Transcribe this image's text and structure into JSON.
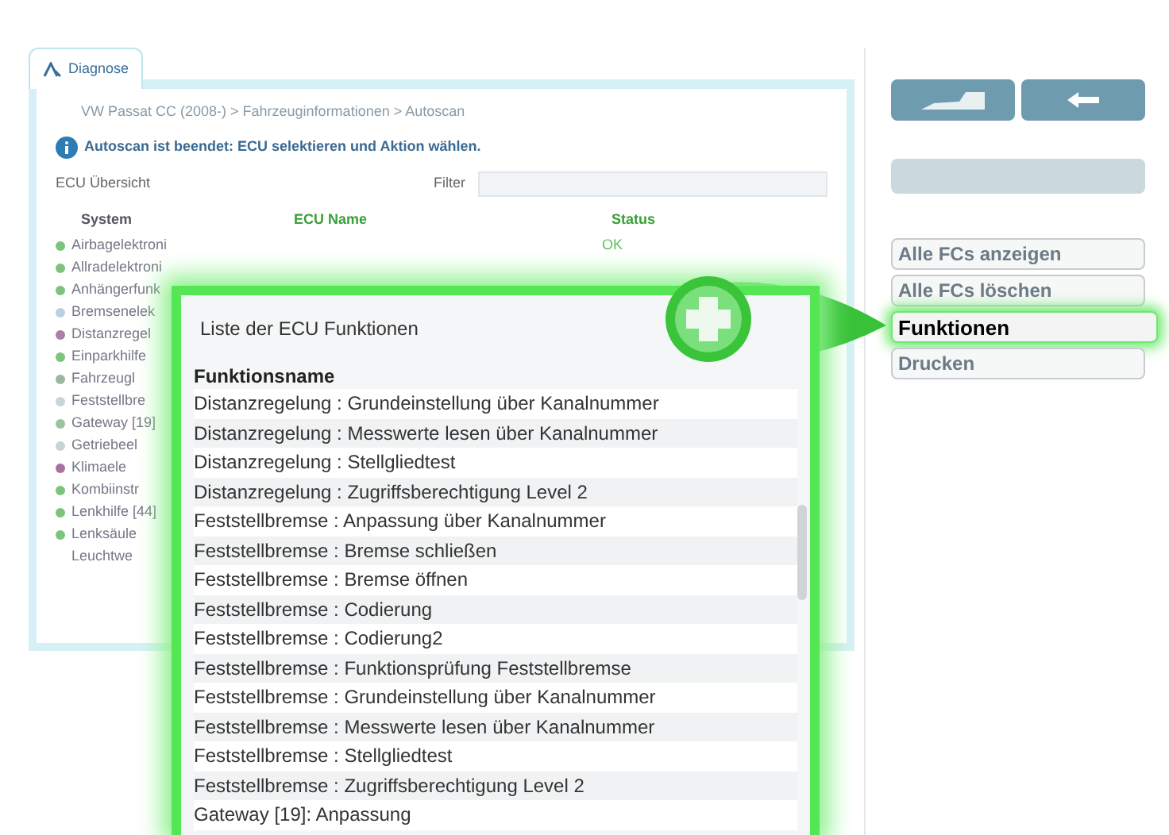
{
  "tab": {
    "label": "Diagnose",
    "selected": true
  },
  "breadcrumb": "VW Passat CC (2008-) > Fahrzeuginformationen > Autoscan",
  "info": "Autoscan ist beendet: ECU selektieren und Aktion wählen.",
  "overview_label": "ECU Übersicht",
  "filter_label": "Filter",
  "table": {
    "columns": [
      "System",
      "ECU Name",
      "Status"
    ],
    "first_status": "OK",
    "rows": [
      {
        "name": "Airbagelektroni",
        "color": "#7cc47c"
      },
      {
        "name": "Allradelektroni",
        "color": "#7cc47c"
      },
      {
        "name": "Anhängerfunk",
        "color": "#7cc47c"
      },
      {
        "name": "Bremsenelek",
        "color": "#b8d0e0"
      },
      {
        "name": "Distanzregel",
        "color": "#a880a8"
      },
      {
        "name": "Einparkhilfe",
        "color": "#7cc47c"
      },
      {
        "name": "Fahrzeugl",
        "color": "#9cb89c"
      },
      {
        "name": "Feststellbre",
        "color": "#c8d4d8"
      },
      {
        "name": "Gateway [19]",
        "color": "#9cc49c"
      },
      {
        "name": "Getriebeel",
        "color": "#c8d4d8"
      },
      {
        "name": "Klimaele",
        "color": "#a870a0"
      },
      {
        "name": "Kombiinstr",
        "color": "#7cc47c"
      },
      {
        "name": "Lenkhilfe [44]",
        "color": "#7cc47c"
      },
      {
        "name": "Lenksäule",
        "color": "#7cc47c"
      },
      {
        "name": "Leuchtwe"
      }
    ]
  },
  "popup": {
    "title": "Liste der ECU Funktionen",
    "column": "Funktionsname",
    "rows": [
      "Distanzregelung : Grundeinstellung über Kanalnummer",
      "Distanzregelung : Messwerte lesen über Kanalnummer",
      "Distanzregelung : Stellgliedtest",
      "Distanzregelung : Zugriffsberechtigung Level 2",
      "Feststellbremse : Anpassung über Kanalnummer",
      "Feststellbremse : Bremse schließen",
      "Feststellbremse : Bremse öffnen",
      "Feststellbremse : Codierung",
      "Feststellbremse : Codierung2",
      "Feststellbremse : Funktionsprüfung Feststellbremse",
      "Feststellbremse : Grundeinstellung über Kanalnummer",
      "Feststellbremse : Messwerte lesen über Kanalnummer",
      "Feststellbremse : Stellgliedtest",
      "Feststellbremse : Zugriffsberechtigung Level 2",
      "Gateway [19]: Anpassung"
    ]
  },
  "actions": [
    {
      "label": "Alle FCs anzeigen",
      "selected": false
    },
    {
      "label": "Alle FCs löschen",
      "selected": false
    },
    {
      "label": "Funktionen",
      "selected": true
    },
    {
      "label": "Drucken",
      "selected": false
    }
  ]
}
